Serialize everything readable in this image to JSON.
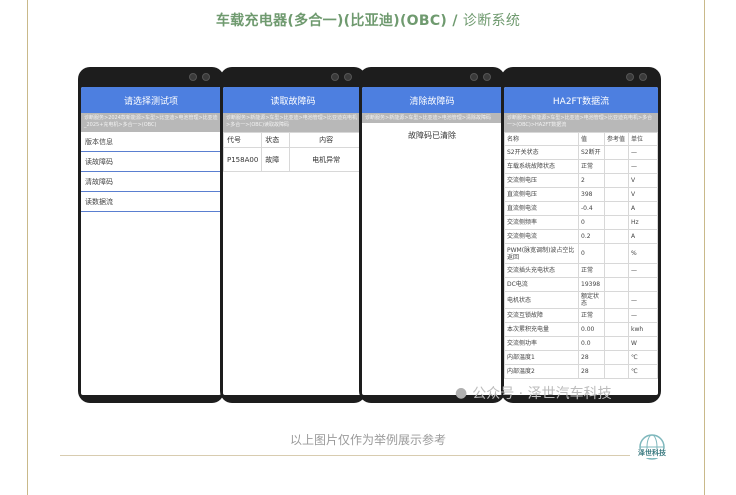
{
  "page": {
    "title_main": "车载充电器(多合一)(比亚迪)(OBC)",
    "title_sep": "/",
    "title_sub": "诊断系统",
    "caption": "以上图片仅作为举例展示参考"
  },
  "phone1": {
    "header": "请选择测试项",
    "breadcrumb": "诊断服务>2024款新能源>车型>比亚迪>电池管理>比亚迪_2025+充电机>多合一>(OBC)",
    "menu": [
      "版本信息",
      "读故障码",
      "清故障码",
      "读数据流"
    ]
  },
  "phone2": {
    "header": "读取故障码",
    "breadcrumb": "诊断服务>新能源>车型>比亚迪>电池管理>比亚迪充电机>多合一>(OBC)读取故障码",
    "columns": [
      "代号",
      "状态",
      "内容"
    ],
    "rows": [
      {
        "code": "P158A00",
        "status": "故障",
        "content": "电机异常"
      }
    ]
  },
  "phone3": {
    "header": "清除故障码",
    "breadcrumb": "诊断服务>新能源>车型>比亚迪>电池管理>清除故障码",
    "message": "故障码已清除"
  },
  "phone4": {
    "header": "HA2FT数据流",
    "breadcrumb": "诊断服务>新能源>车型>比亚迪>电池管理>比亚迪充电机>多合一>(OBC)>HA2FT数据流",
    "columns": [
      "名称",
      "值",
      "参考值",
      "单位"
    ],
    "rows": [
      {
        "name": "S2开关状态",
        "value": "S2断开",
        "ref": "",
        "unit": "—"
      },
      {
        "name": "车载系统故障状态",
        "value": "正常",
        "ref": "",
        "unit": "—"
      },
      {
        "name": "交流侧电压",
        "value": "2",
        "ref": "",
        "unit": "V"
      },
      {
        "name": "直流侧电压",
        "value": "398",
        "ref": "",
        "unit": "V"
      },
      {
        "name": "直流侧电流",
        "value": "-0.4",
        "ref": "",
        "unit": "A"
      },
      {
        "name": "交流侧频率",
        "value": "0",
        "ref": "",
        "unit": "Hz"
      },
      {
        "name": "交流侧电流",
        "value": "0.2",
        "ref": "",
        "unit": "A"
      },
      {
        "name": "PWM(脉宽调制)波占空比返回",
        "value": "0",
        "ref": "",
        "unit": "%"
      },
      {
        "name": "交流插头充电状态",
        "value": "正常",
        "ref": "",
        "unit": "—"
      },
      {
        "name": "DC电流",
        "value": "19398",
        "ref": "",
        "unit": ""
      },
      {
        "name": "电机状态",
        "value": "额定状态",
        "ref": "",
        "unit": "—"
      },
      {
        "name": "交流互锁故障",
        "value": "正常",
        "ref": "",
        "unit": "—"
      },
      {
        "name": "本次累积充电量",
        "value": "0.00",
        "ref": "",
        "unit": "kwh"
      },
      {
        "name": "交流侧功率",
        "value": "0.0",
        "ref": "",
        "unit": "W"
      },
      {
        "name": "内部温度1",
        "value": "28",
        "ref": "",
        "unit": "℃"
      },
      {
        "name": "内部温度2",
        "value": "28",
        "ref": "",
        "unit": "℃"
      }
    ]
  },
  "watermark": {
    "text": "公众号 · 泽世汽车科技"
  },
  "logo": {
    "text": "泽世科技"
  },
  "colors": {
    "appbar": "#4d7fe0",
    "title": "#6f9a6f",
    "caption": "#9a9a9a"
  }
}
